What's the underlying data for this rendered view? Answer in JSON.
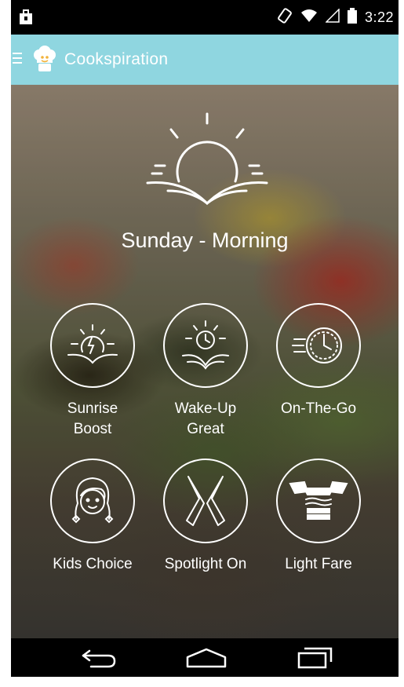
{
  "status_bar": {
    "time": "3:22",
    "icons": [
      "notification-bag-icon",
      "rotation-lock-icon",
      "wifi-icon",
      "signal-icon",
      "battery-icon"
    ]
  },
  "app_bar": {
    "title": "Cookspiration",
    "icons": [
      "menu-icon",
      "chef-hat-logo-icon"
    ],
    "background": "#8fd6e0"
  },
  "header": {
    "day_label": "Sunday - Morning",
    "icon": "sunrise-icon"
  },
  "categories": [
    {
      "label": "Sunrise Boost",
      "icon": "sunrise-lightning-icon"
    },
    {
      "label": "Wake-Up Great",
      "icon": "sun-clock-book-icon"
    },
    {
      "label": "On-The-Go",
      "icon": "speed-clock-icon"
    },
    {
      "label": "Kids Choice",
      "icon": "girl-face-icon"
    },
    {
      "label": "Spotlight On",
      "icon": "crossed-utensils-icon"
    },
    {
      "label": "Light Fare",
      "icon": "winged-sandwich-icon"
    }
  ],
  "nav_bar": {
    "buttons": [
      "back-icon",
      "home-icon",
      "recents-icon"
    ]
  }
}
